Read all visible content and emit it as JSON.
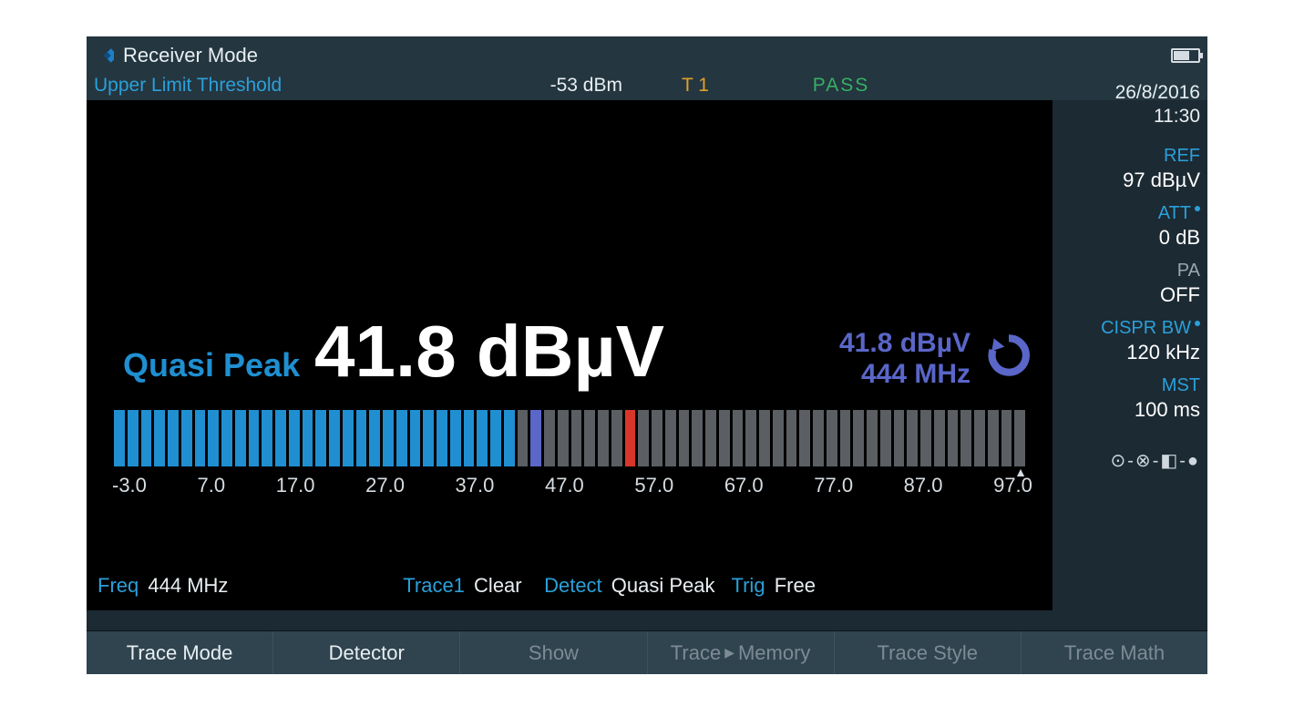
{
  "title": "Receiver Mode",
  "status": {
    "limit_label": "Upper Limit Threshold",
    "limit_value": "-53 dBm",
    "trace": "T 1",
    "result": "PASS"
  },
  "datetime": {
    "date": "26/8/2016",
    "time": "11:30"
  },
  "side": {
    "ref": {
      "label": "REF",
      "value": "97 dBµV"
    },
    "att": {
      "label": "ATT",
      "value": "0 dB"
    },
    "pa": {
      "label": "PA",
      "value": "OFF"
    },
    "cispr": {
      "label": "CISPR BW",
      "value": "120 kHz"
    },
    "mst": {
      "label": "MST",
      "value": "100 ms"
    }
  },
  "reading": {
    "detector_label": "Quasi Peak",
    "value": "41.8 dBµV",
    "marker_level": "41.8 dBµV",
    "marker_freq": "444 MHz"
  },
  "bargraph": {
    "min": -3.0,
    "max": 97.0,
    "segments": 68,
    "active_segments": 30,
    "marker_segment": 31,
    "limit_segment": 38,
    "ticks": [
      "-3.0",
      "7.0",
      "17.0",
      "27.0",
      "37.0",
      "47.0",
      "57.0",
      "67.0",
      "77.0",
      "87.0",
      "97.0"
    ]
  },
  "info": {
    "freq_label": "Freq",
    "freq_value": "444 MHz",
    "trace_label": "Trace1",
    "trace_value": "Clear",
    "detect_label": "Detect",
    "detect_value": "Quasi Peak",
    "trig_label": "Trig",
    "trig_value": "Free"
  },
  "softkeys": {
    "k1": "Trace Mode",
    "k2": "Detector",
    "k3": "Show",
    "k4a": "Trace",
    "k4b": "Memory",
    "k5": "Trace Style",
    "k6": "Trace Math"
  }
}
